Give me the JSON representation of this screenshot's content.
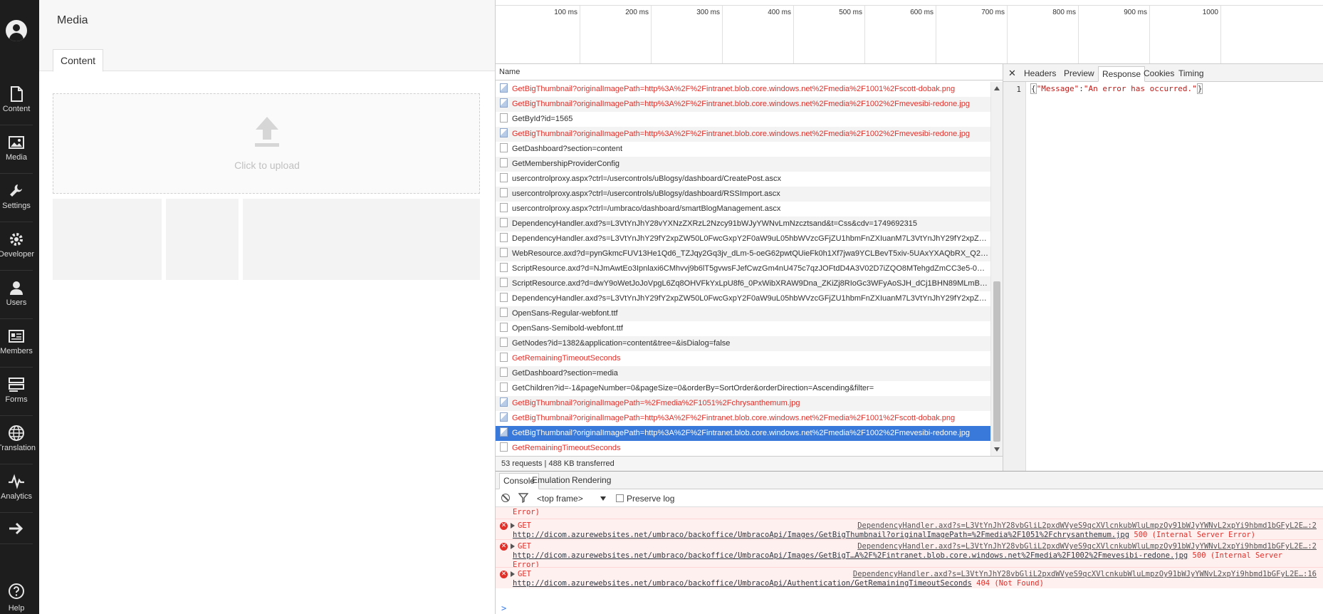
{
  "sidebar": {
    "items": [
      {
        "label": "Content",
        "icon": "content-icon"
      },
      {
        "label": "Media",
        "icon": "media-icon"
      },
      {
        "label": "Settings",
        "icon": "settings-icon"
      },
      {
        "label": "Developer",
        "icon": "developer-icon"
      },
      {
        "label": "Users",
        "icon": "users-icon"
      },
      {
        "label": "Members",
        "icon": "members-icon"
      },
      {
        "label": "Forms",
        "icon": "forms-icon"
      },
      {
        "label": "Translation",
        "icon": "translation-icon"
      },
      {
        "label": "Analytics",
        "icon": "analytics-icon"
      },
      {
        "label": "",
        "icon": "arrow-right-icon"
      },
      {
        "label": "Help",
        "icon": "help-icon"
      }
    ]
  },
  "main": {
    "title": "Media",
    "tab": "Content",
    "upload_text": "Click to upload"
  },
  "timeline": {
    "ticks": [
      "100 ms",
      "200 ms",
      "300 ms",
      "400 ms",
      "500 ms",
      "600 ms",
      "700 ms",
      "800 ms",
      "900 ms",
      "1000"
    ]
  },
  "network": {
    "name_header": "Name",
    "requests": [
      {
        "name": "GetBigThumbnail?originalImagePath=http%3A%2F%2Fintranet.blob.core.windows.net%2Fmedia%2F1001%2Fscott-dobak.png",
        "error": true,
        "type": "img"
      },
      {
        "name": "GetBigThumbnail?originalImagePath=http%3A%2F%2Fintranet.blob.core.windows.net%2Fmedia%2F1002%2Fmevesibi-redone.jpg",
        "error": true,
        "type": "img"
      },
      {
        "name": "GetById?id=1565",
        "error": false,
        "type": "doc"
      },
      {
        "name": "GetBigThumbnail?originalImagePath=http%3A%2F%2Fintranet.blob.core.windows.net%2Fmedia%2F1002%2Fmevesibi-redone.jpg",
        "error": true,
        "type": "img"
      },
      {
        "name": "GetDashboard?section=content",
        "error": false,
        "type": "doc"
      },
      {
        "name": "GetMembershipProviderConfig",
        "error": false,
        "type": "doc"
      },
      {
        "name": "usercontrolproxy.aspx?ctrl=/usercontrols/uBlogsy/dashboard/CreatePost.ascx",
        "error": false,
        "type": "doc"
      },
      {
        "name": "usercontrolproxy.aspx?ctrl=/usercontrols/uBlogsy/dashboard/RSSImport.ascx",
        "error": false,
        "type": "doc"
      },
      {
        "name": "usercontrolproxy.aspx?ctrl=/umbraco/dashboard/smartBlogManagement.ascx",
        "error": false,
        "type": "doc"
      },
      {
        "name": "DependencyHandler.axd?s=L3VtYnJhY28vYXNzZXRzL2Nzcy91bWJyYWNvLmNzcztsand&t=Css&cdv=1749692315",
        "error": false,
        "type": "doc"
      },
      {
        "name": "DependencyHandler.axd?s=L3VtYnJhY29fY2xpZW50L0FwcGxpY2F0aW9uL05hbWVzcGFjZU1hbmFnZXIuanM7L3VtYnJhY29fY2xpZW50L3VpLmpz",
        "error": false,
        "type": "doc"
      },
      {
        "name": "WebResource.axd?d=pynGkmcFUV13He1Qd6_TZJqy2Gq3jv_dLm-5-oeG62pwtQUieFk0h1Xf7jwa9YCLBevT5xiv-5UAxYXAQbRX_Q2&t=636",
        "error": false,
        "type": "doc"
      },
      {
        "name": "ScriptResource.axd?d=NJmAwtEo3Ipnlaxi6CMhvvj9b6lT5gvwsFJefCwzGm4nU475c7qzJOFtdD4A3V02D7iZQO8MTehgdZmCC3e5-0nbDd",
        "error": false,
        "type": "doc"
      },
      {
        "name": "ScriptResource.axd?d=dwY9oWetJoJoVpgL6Zq8OHVFkYxLpU8f6_0PxWibXRAW9Dna_ZKiZj8RIoGc3WFyAoSJH_dCj1BHN89MLmB5iGT-D",
        "error": false,
        "type": "doc"
      },
      {
        "name": "DependencyHandler.axd?s=L3VtYnJhY29fY2xpZW50L0FwcGxpY2F0aW9uL05hbWVzcGFjZU1hbmFnZXIuanM7L3VtYnJhY29fY2xpZW50L3VpLmpz",
        "error": false,
        "type": "doc"
      },
      {
        "name": "OpenSans-Regular-webfont.ttf",
        "error": false,
        "type": "doc"
      },
      {
        "name": "OpenSans-Semibold-webfont.ttf",
        "error": false,
        "type": "doc"
      },
      {
        "name": "GetNodes?id=1382&application=content&tree=&isDialog=false",
        "error": false,
        "type": "doc"
      },
      {
        "name": "GetRemainingTimeoutSeconds",
        "error": true,
        "type": "doc"
      },
      {
        "name": "GetDashboard?section=media",
        "error": false,
        "type": "doc"
      },
      {
        "name": "GetChildren?id=-1&pageNumber=0&pageSize=0&orderBy=SortOrder&orderDirection=Ascending&filter=",
        "error": false,
        "type": "doc"
      },
      {
        "name": "GetBigThumbnail?originalImagePath=%2Fmedia%2F1051%2Fchrysanthemum.jpg",
        "error": true,
        "type": "img"
      },
      {
        "name": "GetBigThumbnail?originalImagePath=http%3A%2F%2Fintranet.blob.core.windows.net%2Fmedia%2F1001%2Fscott-dobak.png",
        "error": true,
        "type": "img"
      },
      {
        "name": "GetBigThumbnail?originalImagePath=http%3A%2F%2Fintranet.blob.core.windows.net%2Fmedia%2F1002%2Fmevesibi-redone.jpg",
        "error": true,
        "type": "img",
        "selected": true
      },
      {
        "name": "GetRemainingTimeoutSeconds",
        "error": true,
        "type": "doc"
      }
    ],
    "summary": "53 requests  |  488 KB transferred"
  },
  "detail": {
    "close": "✕",
    "tabs": [
      "Headers",
      "Preview",
      "Response",
      "Cookies",
      "Timing"
    ],
    "active_tab": "Response",
    "line_no": "1",
    "response_key": "\"Message\"",
    "response_sep": ":",
    "response_val": "\"An error has occurred.\""
  },
  "console": {
    "tabs": [
      "Console",
      "Emulation",
      "Rendering"
    ],
    "frame": "<top frame>",
    "preserve_log": "Preserve log",
    "partial_line": "Error)",
    "messages": [
      {
        "method": "GET",
        "source": "DependencyHandler.axd?s=L3VtYnJhY28vbGliL2pxdWVyeS9qcXVlcnkubWluLmpzOy91bWJyYWNvL2xpYi9hbmd1bGFyL2E…:2",
        "url": "http://dicom.azurewebsites.net/umbraco/backoffice/UmbracoApi/Images/GetBigThumbnail?originalImagePath=%2Fmedia%2F1051%2Fchrysanthemum.jpg",
        "status": " 500 (Internal Server Error)",
        "status_cont": ""
      },
      {
        "method": "GET",
        "source": "DependencyHandler.axd?s=L3VtYnJhY28vbGliL2pxdWVyeS9qcXVlcnkubWluLmpzOy91bWJyYWNvL2xpYi9hbmd1bGFyL2E…:2",
        "url": "http://dicom.azurewebsites.net/umbraco/backoffice/UmbracoApi/Images/GetBigT…A%2F%2Fintranet.blob.core.windows.net%2Fmedia%2F1002%2Fmevesibi-redone.jpg",
        "status": " 500 (Internal Server",
        "status_cont": "Error)"
      },
      {
        "method": "GET",
        "source": "DependencyHandler.axd?s=L3VtYnJhY28vbGliL2pxdWVyeS9qcXVlcnkubWluLmpzOy91bWJyYWNvL2xpYi9hbmd1bGFyL2E…:16",
        "url": "http://dicom.azurewebsites.net/umbraco/backoffice/UmbracoApi/Authentication/GetRemainingTimeoutSeconds",
        "status": " 404 (Not Found)",
        "status_cont": ""
      }
    ],
    "prompt": ">"
  }
}
